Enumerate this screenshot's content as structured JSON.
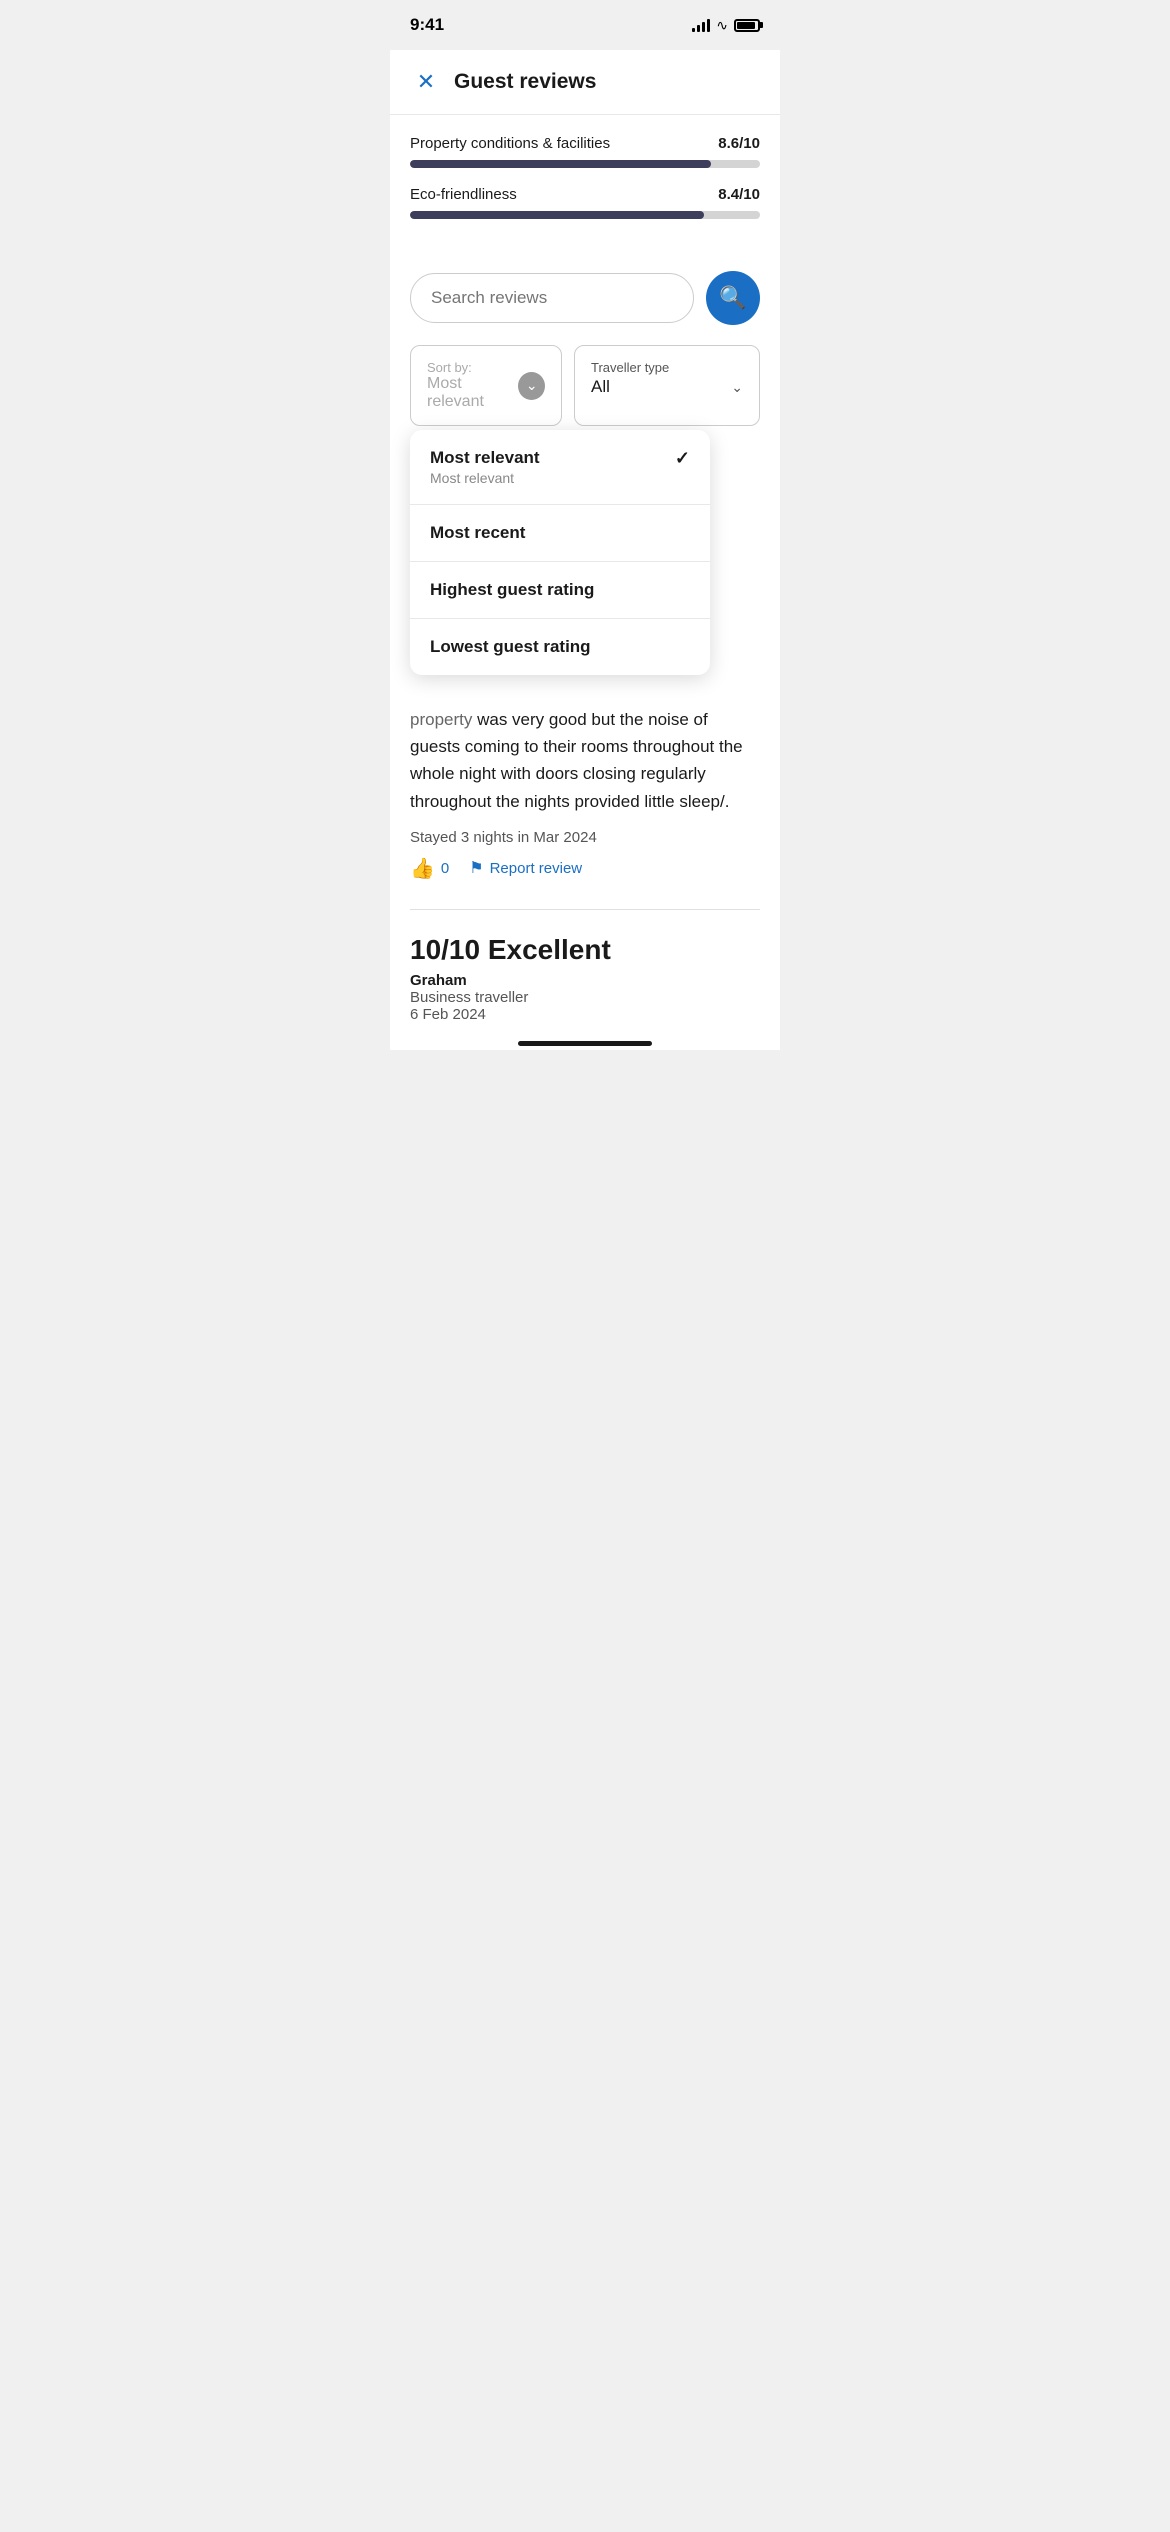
{
  "statusBar": {
    "time": "9:41"
  },
  "header": {
    "title": "Guest reviews",
    "closeLabel": "×"
  },
  "ratings": [
    {
      "label": "Property conditions & facilities",
      "score": "8.6/10",
      "percent": 86
    },
    {
      "label": "Eco-friendliness",
      "score": "8.4/10",
      "percent": 84
    }
  ],
  "search": {
    "placeholder": "Search reviews",
    "searchIconLabel": "search"
  },
  "sortDropdown": {
    "label": "Sort by:",
    "value": "Most relevant",
    "chevronLabel": "chevron-down"
  },
  "travellerDropdown": {
    "label": "Traveller type",
    "value": "All",
    "chevronLabel": "chevron-down"
  },
  "sortMenu": {
    "items": [
      {
        "title": "Most relevant",
        "subtitle": "Most relevant",
        "selected": true
      },
      {
        "title": "Most recent",
        "subtitle": "",
        "selected": false
      },
      {
        "title": "Highest guest rating",
        "subtitle": "",
        "selected": false
      },
      {
        "title": "Lowest guest rating",
        "subtitle": "",
        "selected": false
      }
    ]
  },
  "reviews": [
    {
      "partialText": "was very good but the noise of guests coming to their rooms throughout the whole night with doors closing regularly throughout the nights provided little sleep/.",
      "stayInfo": "Stayed 3 nights in Mar 2024",
      "thumbsCount": "0",
      "reportLabel": "Report review"
    },
    {
      "score": "10/10 Excellent",
      "reviewerName": "Graham",
      "reviewerType": "Business traveller",
      "reviewerDate": "6 Feb 2024"
    }
  ],
  "colors": {
    "blue": "#1a6fc4",
    "barFill": "#3d3d5c",
    "barBg": "#d4d4d4"
  }
}
